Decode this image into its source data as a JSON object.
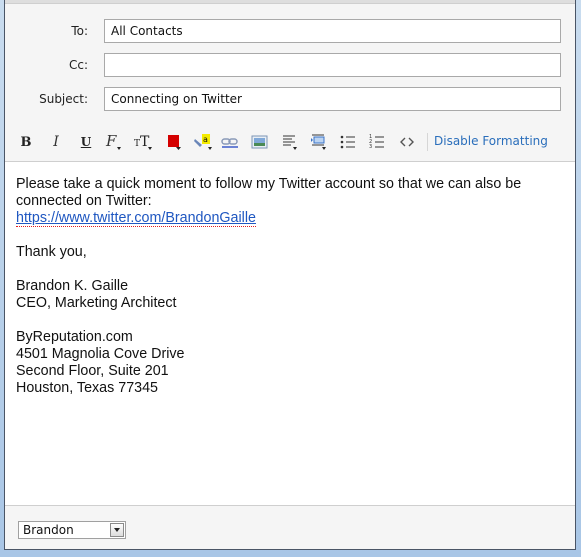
{
  "compose": {
    "to": {
      "label": "To:",
      "value": "All Contacts"
    },
    "cc": {
      "label": "Cc:",
      "value": ""
    },
    "subject": {
      "label": "Subject:",
      "value": "Connecting on Twitter"
    }
  },
  "toolbar": {
    "buttons": [
      {
        "name": "bold",
        "icon": "bold-icon"
      },
      {
        "name": "italic",
        "icon": "italic-icon"
      },
      {
        "name": "underline",
        "icon": "underline-icon"
      },
      {
        "name": "font-family",
        "icon": "font-family-icon"
      },
      {
        "name": "font-size",
        "icon": "font-size-icon"
      },
      {
        "name": "text-color",
        "icon": "text-color-icon",
        "color": "#d40000"
      },
      {
        "name": "highlight",
        "icon": "highlight-icon",
        "color": "#f5ec00"
      },
      {
        "name": "insert-link",
        "icon": "link-icon"
      },
      {
        "name": "insert-image",
        "icon": "image-icon"
      },
      {
        "name": "align",
        "icon": "align-icon"
      },
      {
        "name": "indent",
        "icon": "indent-icon"
      },
      {
        "name": "bulleted-list",
        "icon": "bulleted-list-icon"
      },
      {
        "name": "numbered-list",
        "icon": "numbered-list-icon"
      },
      {
        "name": "html-source",
        "icon": "code-icon"
      }
    ],
    "disable_formatting_label": "Disable Formatting"
  },
  "body": {
    "intro": "Please take a quick moment to follow my Twitter account so that we can also be connected on Twitter:",
    "link": "https://www.twitter.com/BrandonGaille",
    "closing": "Thank you,",
    "signature": {
      "name": "Brandon K. Gaille",
      "title": "CEO, Marketing Architect",
      "company": "ByReputation.com",
      "address1": "4501 Magnolia Cove Drive",
      "address2": "Second Floor, Suite 201",
      "address3": "Houston, Texas 77345"
    }
  },
  "footer": {
    "signature_select": {
      "value": "Brandon"
    }
  },
  "colors": {
    "link": "#1f57c1",
    "disable_formatting": "#2a6ebb",
    "text_color_swatch": "#d40000"
  }
}
